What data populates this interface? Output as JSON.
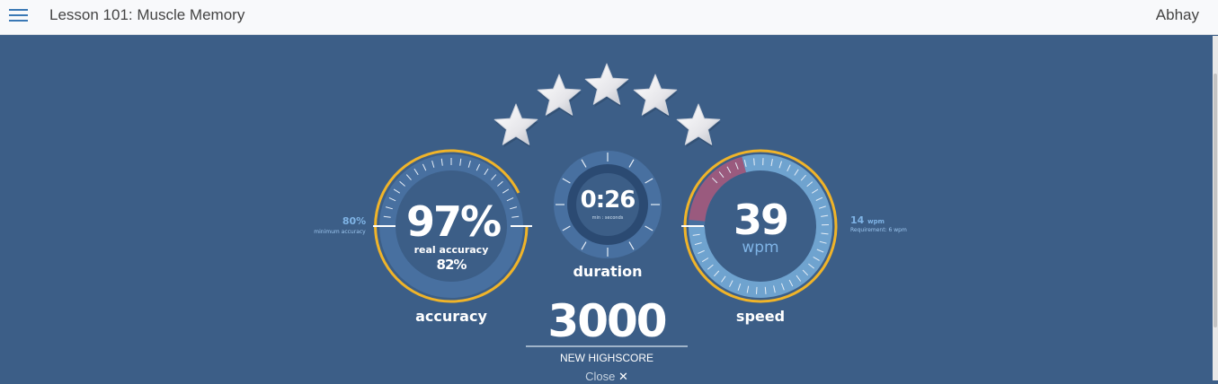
{
  "header": {
    "title": "Lesson 101: Muscle Memory",
    "user": "Abhay"
  },
  "stars": {
    "earned": 5,
    "total": 5
  },
  "accuracy": {
    "value": "97%",
    "real_label": "real accuracy",
    "real_value": "82%",
    "label": "accuracy",
    "min_value": "80%",
    "min_label": "minimum accuracy",
    "fill_fraction": 0.97
  },
  "duration": {
    "value": "0:26",
    "unit": "min : seconds",
    "label": "duration"
  },
  "speed": {
    "value": "39",
    "unit": "wpm",
    "label": "speed",
    "req_value": "14",
    "req_unit": "wpm",
    "req_label": "Requirement: 6 wpm"
  },
  "score": {
    "value": "3000",
    "label": "NEW HIGHSCORE",
    "close_label": "Close",
    "close_icon": "✕"
  },
  "colors": {
    "background": "#3c5e87",
    "ring": "#f0b429",
    "dial": "#4870a0",
    "dial_dark": "#2b4a72",
    "speed_fill": "#6fa3cf",
    "speed_red": "#9a5a7e"
  }
}
